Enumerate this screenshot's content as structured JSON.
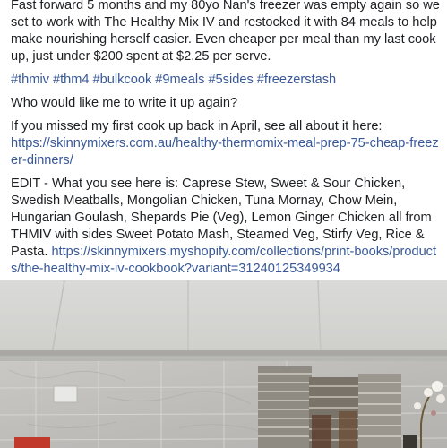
{
  "post": {
    "para1": "Fast forward 5 months and my 80yo Nan's freezer was empty again so we set to work with The Healthy Mix IV and restocked it with 84 meals to help make nourishing herself easier. Even cheaper per meal than my last cook up, just under $200 spent at $2.25 per serve.",
    "hashtags": [
      "#thmiv",
      "#thm4",
      "#bulkcook",
      "#9meals",
      "#5sides",
      "#freezerstash"
    ],
    "question": "Who would like me to write it up again?",
    "prev_intro": "If you missed my first cook up back in April, see all about it here:",
    "prev_link": "https://skinnymixers.com.au/healthy-thermomix-meal-prep-75-cheap-freezer-dinners/",
    "edit_text": "EDIT - What you see here is: Caprese Stew, Sweet & Sour Chicken, Swedish Meatballs, Mongolian Chicken, Tuna Mornay, Chow Mein, Hungarian Goulash, Shepards Pie (Veg), Lemon Ginger Chicken all from THMIV with sides Sweet Potato Mash, Steamed Veg, Stirfy Veg, Rice & Pasta.",
    "edit_link": "https://skinnymixers.myshopify.com/collections/print-books/products/the-healthy-mix-iv-cookbook?variant=31240125349934"
  },
  "colors": {
    "text": "#1c1e21",
    "link": "#385898"
  }
}
